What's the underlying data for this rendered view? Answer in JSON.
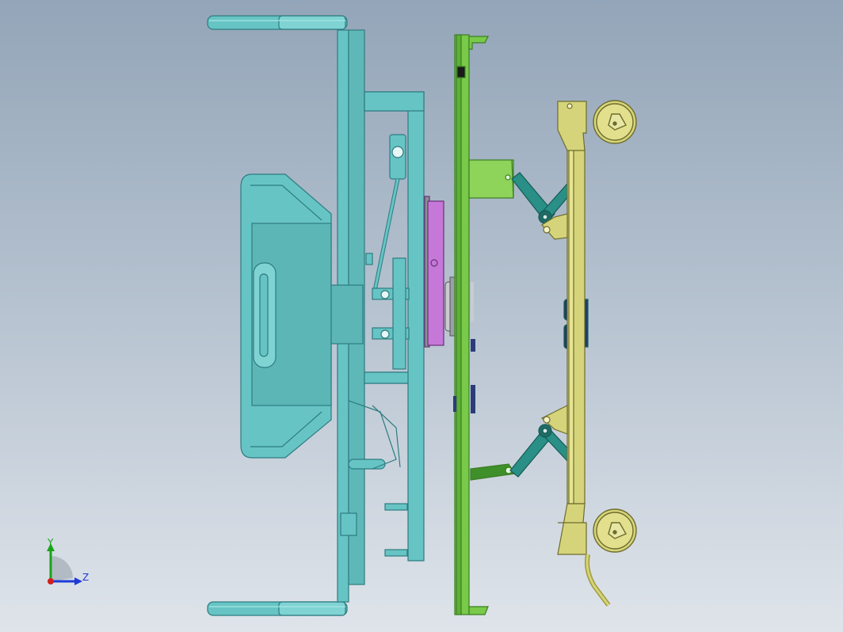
{
  "view": {
    "colors": {
      "frame": "#67c4c4",
      "frame_dark": "#2d7c80",
      "plate": "#79c94a",
      "plate_dark": "#3a7e22",
      "bracket": "#8ed35a",
      "linkage": "#2a8f86",
      "linkage_dark": "#145c56",
      "carriage": "#d6d47a",
      "carriage_dark": "#6e6c2c",
      "magenta": "#c678d8",
      "navy": "#2a3c7a",
      "grey_disc": "#c8ccd0"
    }
  },
  "triad": {
    "x_label": "Z",
    "y_label": "Y",
    "y_color": "#19a319",
    "z_color": "#1e3ad6",
    "origin_color": "#d21e1e"
  }
}
